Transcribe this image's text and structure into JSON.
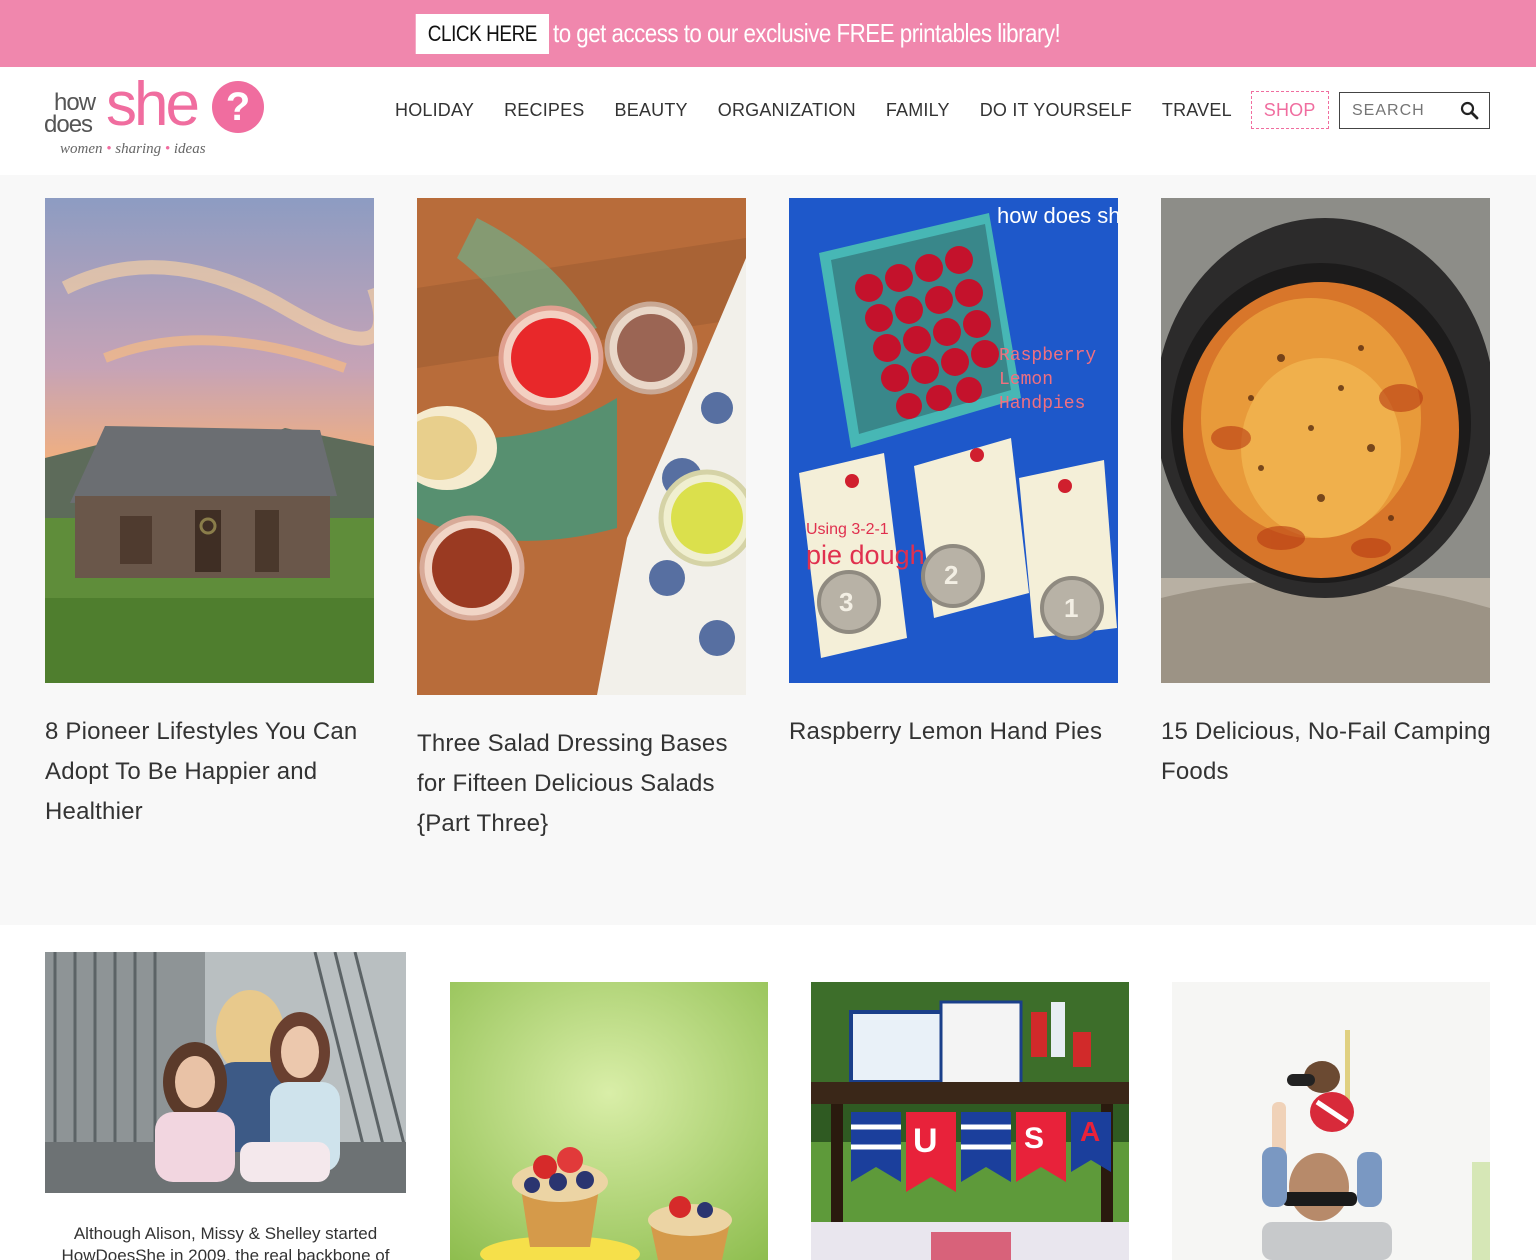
{
  "promo": {
    "button_label": "CLICK HERE",
    "text": "to get access to our exclusive FREE printables library!"
  },
  "logo": {
    "how": "how",
    "does": "does",
    "she": "she",
    "q": "?",
    "tagline_1": "women",
    "tagline_2": "sharing",
    "tagline_3": "ideas"
  },
  "nav": {
    "items": [
      "HOLIDAY",
      "RECIPES",
      "BEAUTY",
      "ORGANIZATION",
      "FAMILY",
      "DO IT YOURSELF",
      "TRAVEL",
      "SHOP"
    ]
  },
  "search": {
    "placeholder": "SEARCH"
  },
  "featured": [
    {
      "title": "8 Pioneer Lifestyles You Can Adopt To Be Happier and Healthier"
    },
    {
      "title": "Three Salad Dressing Bases for Fifteen Delicious Salads {Part Three}"
    },
    {
      "title": "Raspberry Lemon Hand Pies",
      "image_text_1": "Raspberry",
      "image_text_2": "Lemon",
      "image_text_3": "Handpies",
      "image_text_4": "Using 3-2-1",
      "image_text_5": "pie dough",
      "tag_3": "3",
      "tag_2": "2",
      "tag_1": "1",
      "watermark": "how does she"
    },
    {
      "title": "15 Delicious, No-Fail Camping Foods"
    }
  ],
  "lower": {
    "about_text": "Although Alison, Missy & Shelley started HowDoesShe in 2009, the real backbone of",
    "banner_letters": [
      "U",
      "S",
      "A"
    ]
  },
  "colors": {
    "brand_pink": "#f06d9f",
    "promo_bg": "#f087ad"
  }
}
